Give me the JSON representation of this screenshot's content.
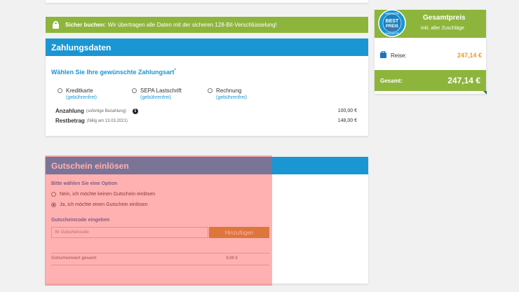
{
  "secure_bar": {
    "bold": "Sicher buchen:",
    "text": "Wir übertragen alle Daten mit der sicheren 128-Bit-Verschlüsselung!",
    "icon": "lock-icon"
  },
  "payment": {
    "header": "Zahlungsdaten",
    "question": "Wählen Sie Ihre gewünschte Zahlungsart",
    "required_mark": "*",
    "options": [
      {
        "label": "Kreditkarte",
        "sub": "(gebührenfrei)",
        "checked": false
      },
      {
        "label": "SEPA Lastschrift",
        "sub": "(gebührenfrei)",
        "checked": false
      },
      {
        "label": "Rechnung",
        "sub": "(gebührenfrei)",
        "checked": false
      }
    ],
    "anzahlung": {
      "label": "Anzahlung",
      "note": "(sofortige Bezahlung)",
      "value": "100,00 €"
    },
    "restbetrag": {
      "label": "Restbetrag",
      "note": "(fällig am 13.03.2021)",
      "value": "148,00 €"
    }
  },
  "voucher": {
    "header": "Gutschein einlösen",
    "choose_title": "Bitte wählen Sie eine Option",
    "options": [
      {
        "label": "Nein, ich möchte keinen Gutschein einlösen",
        "checked": false
      },
      {
        "label": "Ja, ich möchte einen Gutschein einlösen",
        "checked": true
      }
    ],
    "code_title": "Gutscheincode eingeben",
    "input_placeholder": "Ihr Gutscheincode",
    "add_button": "Hinzufügen",
    "total_label": "Gutscheinwert gesamt",
    "total_value": "0,00 €"
  },
  "price": {
    "title": "Gesamtpreis",
    "subtitle": "inkl. aller Zuschläge",
    "badge_top": "GARANTIE",
    "badge_mid1": "BEST",
    "badge_mid2": "PREIS",
    "badge_bottom": "GARANTIE",
    "reise_label": "Reise:",
    "reise_value": "247,14 €",
    "total_label": "Gesamt:",
    "total_value": "247,14 €"
  },
  "colors": {
    "green": "#8db53c",
    "blue": "#1a96d2",
    "orange": "#f29a1e",
    "gold_button": "#c39a33",
    "overlay": "rgba(255,70,70,0.42)"
  }
}
